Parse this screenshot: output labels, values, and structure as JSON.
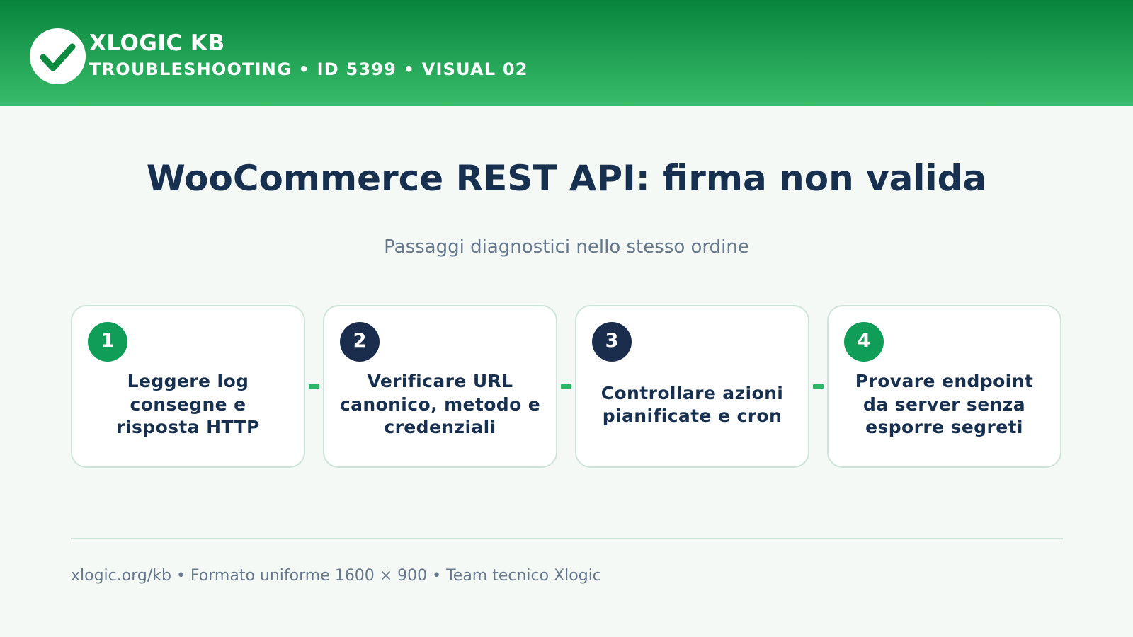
{
  "header": {
    "brand": "XLOGIC KB",
    "subtitle": "TROUBLESHOOTING • ID 5399 • VISUAL 02",
    "logo_icon": "check-circle-icon"
  },
  "main": {
    "title": "WooCommerce REST API: firma non valida",
    "subtitle": "Passaggi diagnostici nello stesso ordine"
  },
  "steps": [
    {
      "number": "1",
      "text": "Leggere log\nconsegne e\nrisposta HTTP",
      "badge_color": "#0f9d58"
    },
    {
      "number": "2",
      "text": "Verificare URL\ncanonico, metodo e\ncredenziali",
      "badge_color": "#1b2d4d"
    },
    {
      "number": "3",
      "text": "Controllare azioni\npianificate e cron",
      "badge_color": "#1b2d4d"
    },
    {
      "number": "4",
      "text": "Provare endpoint\nda server senza\nesporre segreti",
      "badge_color": "#0f9d58"
    }
  ],
  "footer": {
    "text": "xlogic.org/kb • Formato uniforme 1600 × 900 • Team tecnico Xlogic"
  },
  "colors": {
    "header_dark": "#08843c",
    "header_light": "#38bd6b",
    "title": "#18304f",
    "muted": "#66788c",
    "accent": "#2fb565"
  }
}
